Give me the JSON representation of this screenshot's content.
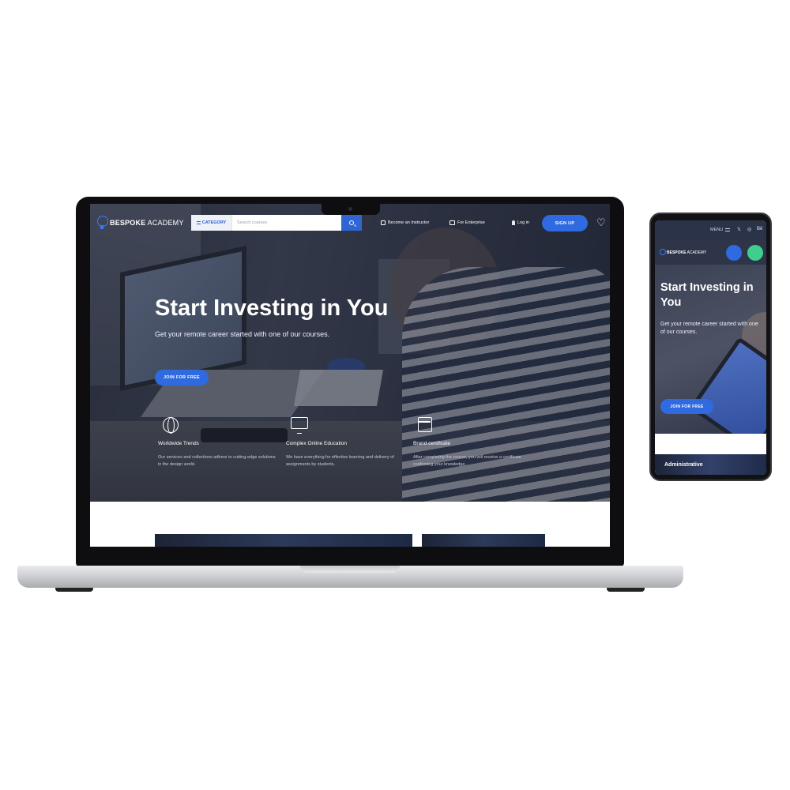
{
  "brand": {
    "name_bold": "BESPOKE",
    "name_light": "ACADEMY"
  },
  "desktop": {
    "nav": {
      "category_label": "CATEGORY",
      "search_placeholder": "Search courses",
      "become_instructor": "Become an Instructor",
      "for_enterprise": "For Enterprise",
      "login": "Log in",
      "signup": "SIGN UP"
    },
    "hero": {
      "title": "Start Investing in You",
      "subtitle": "Get your remote career started with one of our courses.",
      "cta": "JOIN FOR FREE"
    },
    "features": [
      {
        "icon": "globe-icon",
        "title": "Worldwide Trends",
        "desc": "Our services and collections adhere to cutting-edge solutions in the design world."
      },
      {
        "icon": "monitor-icon",
        "title": "Complex Online Education",
        "desc": "We have everything for effective learning and delivery of assignments by students."
      },
      {
        "icon": "calendar-icon",
        "title": "Brand certificate",
        "desc": "After completing the course, you will receive a certificate confirming your knowledge."
      }
    ]
  },
  "mobile": {
    "menu_label": "MENU",
    "social": [
      "𝕏",
      "◎",
      "Bē"
    ],
    "hero": {
      "title": "Start Investing in You",
      "subtitle": "Get your remote career started with one of our courses.",
      "cta": "JOIN FOR FREE"
    },
    "card_title": "Administrative"
  },
  "colors": {
    "accent": "#2f6ae0",
    "circle_blue": "#2f6ae0",
    "circle_green": "#3ecf8e"
  }
}
